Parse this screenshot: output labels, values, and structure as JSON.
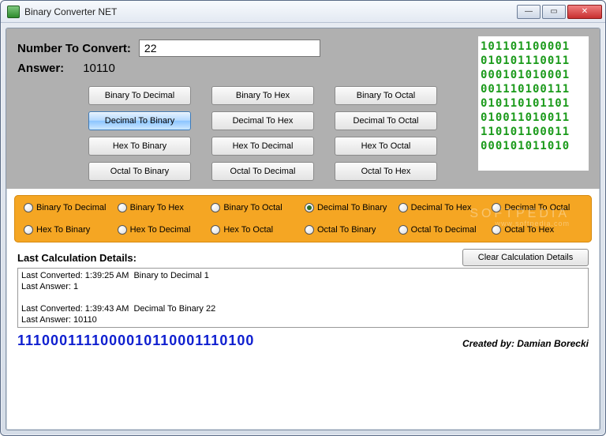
{
  "window": {
    "title": "Binary Converter NET"
  },
  "input": {
    "label": "Number To Convert:",
    "value": "22"
  },
  "answer": {
    "label": "Answer:",
    "value": "10110"
  },
  "buttons": [
    {
      "label": "Binary To Decimal",
      "active": false
    },
    {
      "label": "Binary To Hex",
      "active": false
    },
    {
      "label": "Binary To Octal",
      "active": false
    },
    {
      "label": "Decimal To Binary",
      "active": true
    },
    {
      "label": "Decimal To Hex",
      "active": false
    },
    {
      "label": "Decimal To Octal",
      "active": false
    },
    {
      "label": "Hex To Binary",
      "active": false
    },
    {
      "label": "Hex To Decimal",
      "active": false
    },
    {
      "label": "Hex To Octal",
      "active": false
    },
    {
      "label": "Octal To Binary",
      "active": false
    },
    {
      "label": "Octal To Decimal",
      "active": false
    },
    {
      "label": "Octal To Hex",
      "active": false
    }
  ],
  "radios": [
    {
      "label": "Binary To Decimal",
      "checked": false
    },
    {
      "label": "Binary To Hex",
      "checked": false
    },
    {
      "label": "Binary To Octal",
      "checked": false
    },
    {
      "label": "Decimal To Binary",
      "checked": true
    },
    {
      "label": "Decimal To Hex",
      "checked": false
    },
    {
      "label": "Decimal To Octal",
      "checked": false
    },
    {
      "label": "Hex To Binary",
      "checked": false
    },
    {
      "label": "Hex To Decimal",
      "checked": false
    },
    {
      "label": "Hex To Octal",
      "checked": false
    },
    {
      "label": "Octal To Binary",
      "checked": false
    },
    {
      "label": "Octal To Decimal",
      "checked": false
    },
    {
      "label": "Octal To Hex",
      "checked": false
    }
  ],
  "art_lines": "101101100001\n010101110011\n000101010001\n001110100111\n010110101101\n010011010011\n110101100011\n000101011010",
  "details": {
    "title": "Last Calculation Details:",
    "clear_label": "Clear Calculation Details",
    "log": "Last Converted: 1:39:25 AM  Binary to Decimal 1\nLast Answer: 1\n\nLast Converted: 1:39:43 AM  Decimal To Binary 22\nLast Answer: 10110"
  },
  "footer": {
    "binary_string": "1110001111000010110001110100",
    "credit": "Created by: Damian Borecki"
  },
  "watermark": {
    "brand": "SOFTPEDIA",
    "url": "www.softpedia.com"
  }
}
